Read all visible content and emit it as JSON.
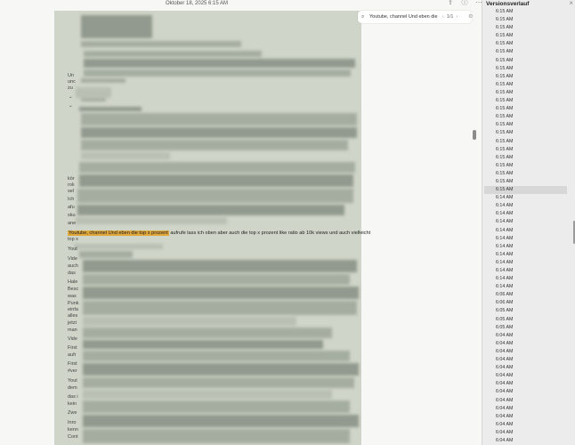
{
  "document": {
    "date_header": "Oktober 18, 2025 6:15 AM",
    "highlight_term": "Youtube, channel Und eben die top x prozent",
    "highlight_rest": " aufrufe lass ich oben aber auch die top x prozent like ratio ab 10k views und auch vielleicht",
    "fragments": [
      "Un",
      "unc",
      "zu",
      "kör",
      "rolı",
      "sel",
      "Ich",
      "afu",
      "sku",
      "ane",
      "top x",
      "Yout",
      "Vide",
      "auch",
      "das",
      "Hale",
      "Besc",
      "was",
      "Punk",
      "einfa",
      "alles",
      "jetzt",
      "man",
      "Vide",
      "First",
      "aufr",
      "First",
      "#ver",
      "Yout",
      "dem",
      "das i",
      "kein",
      "Zwe",
      "Inro",
      "kenn",
      "Cont"
    ]
  },
  "find_bar": {
    "icon": "magnifier-icon",
    "query": "Youtube, channel Und eben die top x",
    "count": "1/1",
    "prev": "‹",
    "next": "›"
  },
  "versions_panel": {
    "title": "Versionsverlauf",
    "selected_index": 22,
    "items": [
      "6:15 AM",
      "6:15 AM",
      "6:15 AM",
      "6:15 AM",
      "6:15 AM",
      "6:15 AM",
      "6:15 AM",
      "6:15 AM",
      "6:15 AM",
      "6:15 AM",
      "6:15 AM",
      "6:15 AM",
      "6:15 AM",
      "6:15 AM",
      "6:15 AM",
      "6:15 AM",
      "6:15 AM",
      "6:15 AM",
      "6:15 AM",
      "6:15 AM",
      "6:15 AM",
      "6:15 AM",
      "6:15 AM",
      "6:14 AM",
      "6:14 AM",
      "6:14 AM",
      "6:14 AM",
      "6:14 AM",
      "6:14 AM",
      "6:14 AM",
      "6:14 AM",
      "6:14 AM",
      "6:14 AM",
      "6:14 AM",
      "6:14 AM",
      "6:06 AM",
      "6:06 AM",
      "6:05 AM",
      "6:05 AM",
      "6:05 AM",
      "6:04 AM",
      "6:04 AM",
      "6:04 AM",
      "6:04 AM",
      "6:04 AM",
      "6:04 AM",
      "6:04 AM",
      "6:04 AM",
      "6:04 AM",
      "6:04 AM",
      "6:04 AM",
      "6:04 AM",
      "6:04 AM",
      "6:04 AM"
    ]
  }
}
